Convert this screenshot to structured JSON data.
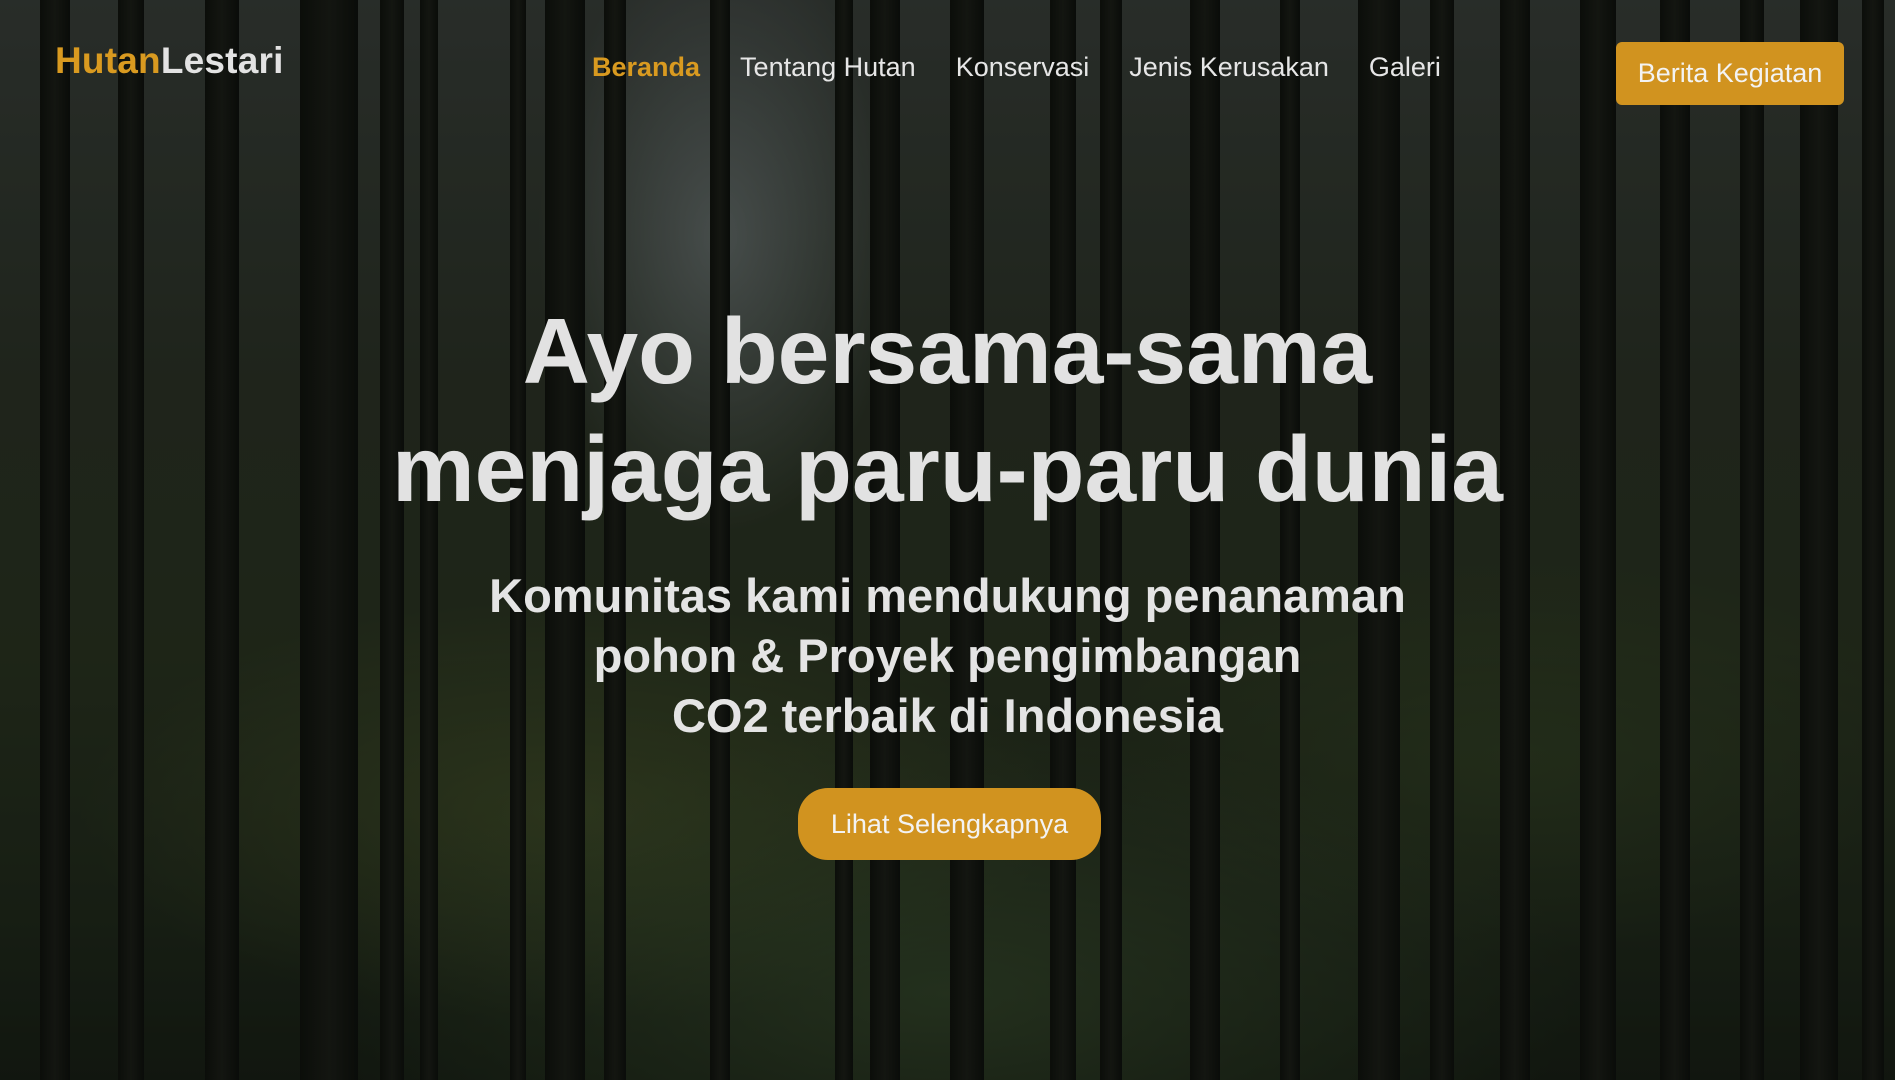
{
  "header": {
    "logo": {
      "part_a": "Hutan",
      "part_b": "Lestari"
    },
    "nav": [
      {
        "label": "Beranda",
        "active": true
      },
      {
        "label": "Tentang Hutan",
        "active": false
      },
      {
        "label": "Konservasi",
        "active": false
      },
      {
        "label": "Jenis Kerusakan",
        "active": false
      },
      {
        "label": "Galeri",
        "active": false
      }
    ],
    "cta_label": "Berita Kegiatan"
  },
  "hero": {
    "title_line1": "Ayo bersama-sama",
    "title_line2": "menjaga paru-paru dunia",
    "subtitle_line1": "Komunitas kami mendukung penanaman",
    "subtitle_line2": "pohon & Proyek pengimbangan",
    "subtitle_line3": "CO2 terbaik di Indonesia",
    "button_label": "Lihat Selengkapnya"
  },
  "colors": {
    "accent": "#d99a20",
    "button": "#d1931f",
    "text": "#e3e3e3"
  }
}
